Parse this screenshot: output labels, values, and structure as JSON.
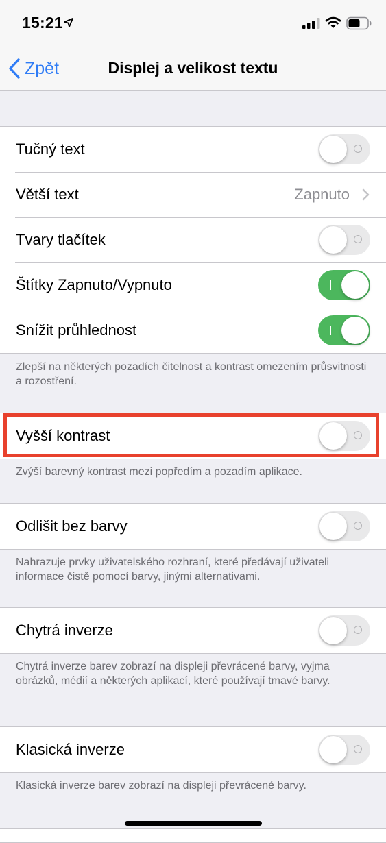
{
  "status_bar": {
    "time": "15:21",
    "icons": [
      "location-arrow-icon",
      "signal-icon",
      "wifi-icon",
      "battery-icon"
    ]
  },
  "nav": {
    "back_label": "Zpět",
    "title": "Displej a velikost textu"
  },
  "colors": {
    "accent": "#2f7cf6",
    "toggle_on": "#4cb75d",
    "toggle_off": "#e9e9ea",
    "highlight": "#e8412d",
    "background": "#efeff4"
  },
  "group1": {
    "rows": [
      {
        "label": "Tučný text",
        "toggle": false
      },
      {
        "label": "Větší text",
        "value": "Zapnuto"
      },
      {
        "label": "Tvary tlačítek",
        "toggle": false
      },
      {
        "label": "Štítky Zapnuto/Vypnuto",
        "toggle": true
      },
      {
        "label": "Snížit průhlednost",
        "toggle": true
      }
    ],
    "footer": "Zlepší na některých pozadích čitelnost a kontrast omezením průsvitnosti a rozostření."
  },
  "group2": {
    "row": {
      "label": "Vyšší kontrast",
      "toggle": false
    },
    "footer": "Zvýší barevný kontrast mezi popředím a pozadím aplikace."
  },
  "group3": {
    "row": {
      "label": "Odlišit bez barvy",
      "toggle": false
    },
    "footer": "Nahrazuje prvky uživatelského rozhraní, které předávají uživateli informace čistě pomocí barvy, jinými alternativami."
  },
  "group4": {
    "row": {
      "label": "Chytrá inverze",
      "toggle": false
    },
    "footer": "Chytrá inverze barev zobrazí na displeji převrácené barvy, vyjma obrázků, médií a některých aplikací, které používají tmavé barvy."
  },
  "group5": {
    "row": {
      "label": "Klasická inverze",
      "toggle": false
    },
    "footer": "Klasická inverze barev zobrazí na displeji převrácené barvy."
  }
}
